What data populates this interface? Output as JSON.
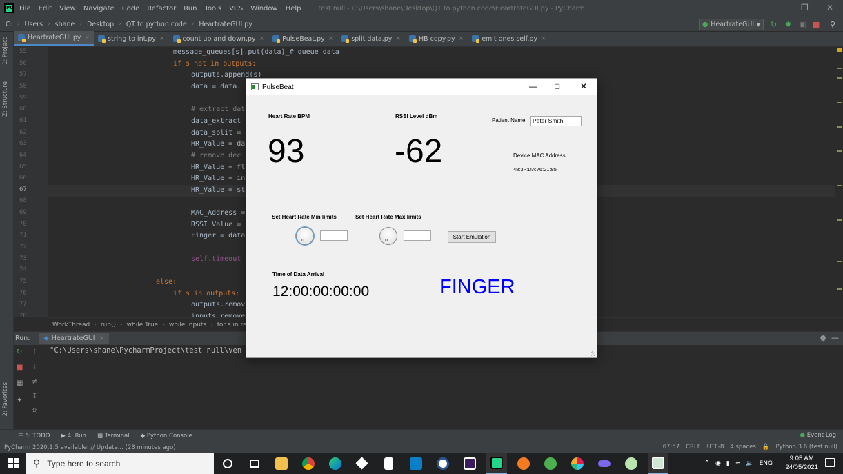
{
  "ide": {
    "menu": [
      "File",
      "Edit",
      "View",
      "Navigate",
      "Code",
      "Refactor",
      "Run",
      "Tools",
      "VCS",
      "Window",
      "Help"
    ],
    "window_title": "test null - C:\\Users\\shane\\Desktop\\QT to python code\\HeartrateGUI.py - PyCharm",
    "breadcrumbs": [
      "C:",
      "Users",
      "shane",
      "Desktop",
      "QT to python code",
      "HeartrateGUI.py"
    ],
    "run_config": "HeartrateGUI",
    "tabs": [
      {
        "label": "HeartrateGUI.py",
        "active": true
      },
      {
        "label": "string to int.py"
      },
      {
        "label": "count up and down.py"
      },
      {
        "label": "PulseBeat.py"
      },
      {
        "label": "split data.py"
      },
      {
        "label": "HB copy.py"
      },
      {
        "label": "emit ones self.py"
      }
    ],
    "side_labels": [
      "1: Project",
      "Z: Structure",
      "2: Favorites"
    ],
    "line_numbers": [
      "55",
      "56",
      "57",
      "58",
      "59",
      "60",
      "61",
      "62",
      "63",
      "64",
      "65",
      "66",
      "67",
      "68",
      "69",
      "70",
      "71",
      "72",
      "73",
      "74",
      "75",
      "76",
      "77",
      "78"
    ],
    "code_lines": [
      "message_queues[s].put(data)_# queue data",
      "if s not in outputs:",
      "outputs.append(s)",
      "data = data.",
      "",
      "# extract dat",
      "data_extract",
      "data_split =",
      "HR_Value = da",
      "# remove dec",
      "HR_Value = fl",
      "HR_Value = in",
      "HR_Value = st",
      "",
      "MAC_Address =",
      "RSSI_Value =",
      "Finger = data",
      "",
      "self.timeout",
      "",
      "else:",
      "if s in outputs:",
      "outputs.remov",
      "inputs.remove(s)"
    ],
    "editor_breadcrumb": [
      "WorkThread",
      "run()",
      "while True",
      "while inputs",
      "for s in re"
    ],
    "run_label": "Run:",
    "run_tab": "HeartrateGUI",
    "run_output": "\"C:\\Users\\shane\\PycharmProject\\test null\\ven",
    "bottom_tabs": [
      "6: TODO",
      "4: Run",
      "Terminal",
      "Python Console"
    ],
    "event_log": "Event Log",
    "status_message": "PyCharm 2020.1.5 available: // Update... (28 minutes ago)",
    "status_right": [
      "67:57",
      "CRLF",
      "UTF-8",
      "4 spaces",
      "Python 3.6 (test null)"
    ]
  },
  "pulsebeat": {
    "title": "PulseBeat",
    "heart_rate_label": "Heart Rate BPM",
    "heart_rate_value": "93",
    "rssi_label": "RSSI Level dBm",
    "rssi_value": "-62",
    "patient_name_label": "Patient Name",
    "patient_name_value": "Peter Smith",
    "mac_label": "Device MAC Address",
    "mac_value": "48:3F:DA:76:21:85",
    "hr_min_label": "Set Heart Rate Min limits",
    "hr_max_label": "Set Heart Rate Max limits",
    "emulation_button": "Start Emulation",
    "time_label": "Time of Data Arrival",
    "time_value": "12:00:00:00:00",
    "finger_status": "FINGER",
    "finger_color": "#0000ff"
  },
  "taskbar": {
    "search_placeholder": "Type here to search",
    "language": "ENG",
    "time": "9:05 AM",
    "date": "24/05/2021"
  }
}
